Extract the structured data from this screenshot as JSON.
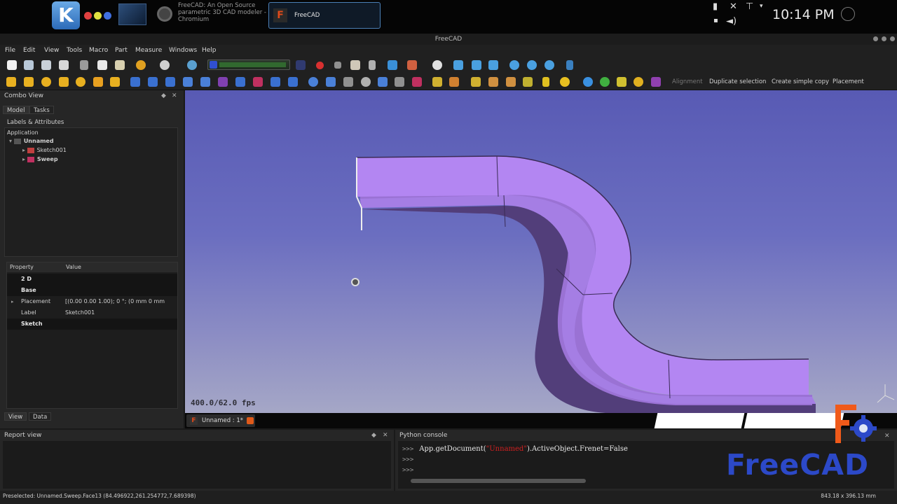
{
  "kde_panel": {
    "launcher_icon": "kde-k-icon",
    "tasks": [
      {
        "label": "FreeCAD: An Open Source parametric 3D CAD modeler - Chromium",
        "line1": "FreeCAD: An Open Source",
        "line2": "parametric 3D CAD modeler -",
        "line3": "Chromium",
        "active": false
      },
      {
        "label": "FreeCAD",
        "active": true
      }
    ],
    "clock": "10:14 PM"
  },
  "window": {
    "title": "FreeCAD"
  },
  "menubar": {
    "items": [
      "File",
      "Edit",
      "View",
      "Tools",
      "Macro",
      "Part",
      "Measure",
      "Windows",
      "Help"
    ]
  },
  "toolbar2_text_buttons": [
    "Alignment",
    "Duplicate selection",
    "Create simple copy",
    "Placement"
  ],
  "combo_view": {
    "title": "Combo View",
    "tabs": [
      "Model",
      "Tasks"
    ],
    "labels_header": "Labels & Attributes",
    "tree": {
      "root": "Application",
      "document": "Unnamed",
      "children": [
        "Sketch001",
        "Sweep"
      ]
    },
    "property_table": {
      "col_property": "Property",
      "col_value": "Value",
      "rows": [
        {
          "type": "group",
          "name": "2 D"
        },
        {
          "type": "group",
          "name": "Base"
        },
        {
          "type": "prop",
          "name": "Placement",
          "value": "[(0.00 0.00 1.00); 0 °; (0 mm  0 mm",
          "expandable": true
        },
        {
          "type": "prop",
          "name": "Label",
          "value": "Sketch001"
        },
        {
          "type": "group",
          "name": "Sketch"
        }
      ]
    },
    "bottom_tabs": [
      "View",
      "Data"
    ]
  },
  "view3d": {
    "fps": "400.0/62.0 fps",
    "model_color": "#b084f0"
  },
  "doc_tabs": {
    "active": "Unnamed : 1*"
  },
  "report_view": {
    "title": "Report view"
  },
  "python_console": {
    "title": "Python console",
    "lines": [
      {
        "prompt": ">>>",
        "pre": "App.getDocument(",
        "str": "\"Unnamed\"",
        "post": ").ActiveObject.Frenet=False"
      },
      {
        "prompt": ">>>",
        "pre": "",
        "str": "",
        "post": ""
      },
      {
        "prompt": ">>>",
        "pre": "",
        "str": "",
        "post": ""
      }
    ]
  },
  "status": {
    "left": "Preselected: Unnamed.Sweep.Face13 (84.496922,261.254772,7.689398)",
    "right": "843.18 x 396.13 mm"
  },
  "logo": {
    "text": "FreeCAD"
  }
}
